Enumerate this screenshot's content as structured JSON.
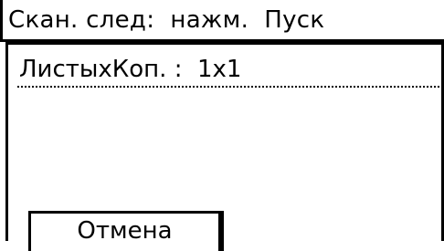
{
  "header": {
    "title": "Скан. след:  нажм.  Пуск"
  },
  "main": {
    "sheets_copies_label": "ЛистыхКоп. :  1x1"
  },
  "footer": {
    "cancel_label": "Отмена"
  }
}
